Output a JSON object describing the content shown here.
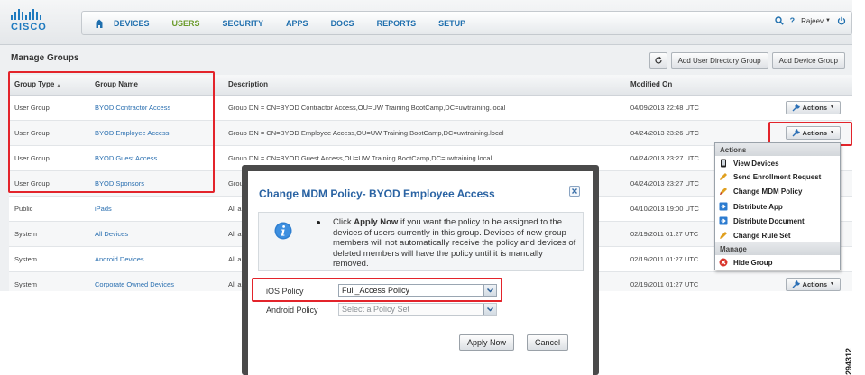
{
  "brand": {
    "logo_text": "CISCO"
  },
  "nav": {
    "items": [
      "DEVICES",
      "USERS",
      "SECURITY",
      "APPS",
      "DOCS",
      "REPORTS",
      "SETUP"
    ],
    "active": "USERS",
    "user": "Rajeev"
  },
  "page": {
    "title": "Manage Groups",
    "toolbar": {
      "add_directory_group": "Add User Directory Group",
      "add_device_group": "Add Device Group"
    }
  },
  "table": {
    "columns": [
      "Group Type",
      "Group Name",
      "Description",
      "Modified On"
    ],
    "sort_indicator": "▲",
    "action_label": "Actions",
    "rows": [
      {
        "type": "User Group",
        "name": "BYOD Contractor Access",
        "desc": "Group DN = CN=BYOD Contractor Access,OU=UW Training BootCamp,DC=uwtraining.local",
        "modified": "04/09/2013 22:48 UTC",
        "actions": true
      },
      {
        "type": "User Group",
        "name": "BYOD Employee Access",
        "desc": "Group DN = CN=BYOD Employee Access,OU=UW Training BootCamp,DC=uwtraining.local",
        "modified": "04/24/2013 23:26 UTC",
        "actions": true
      },
      {
        "type": "User Group",
        "name": "BYOD Guest Access",
        "desc": "Group DN = CN=BYOD Guest Access,OU=UW Training BootCamp,DC=uwtraining.local",
        "modified": "04/24/2013 23:27 UTC",
        "actions": false
      },
      {
        "type": "User Group",
        "name": "BYOD Sponsors",
        "desc": "Grou",
        "modified": "04/24/2013 23:27 UTC",
        "actions": false
      },
      {
        "type": "Public",
        "name": "iPads",
        "desc": "All a",
        "modified": "04/10/2013 19:00 UTC",
        "actions": false
      },
      {
        "type": "System",
        "name": "All Devices",
        "desc": "All a",
        "modified": "02/19/2011 01:27 UTC",
        "actions": false
      },
      {
        "type": "System",
        "name": "Android Devices",
        "desc": "All a",
        "modified": "02/19/2011 01:27 UTC",
        "actions": false
      },
      {
        "type": "System",
        "name": "Corporate Owned Devices",
        "desc": "All a",
        "modified": "02/19/2011 01:27 UTC",
        "actions": true
      }
    ]
  },
  "actions_menu": {
    "section_actions": "Actions",
    "items": [
      "View Devices",
      "Send Enrollment Request",
      "Change MDM Policy",
      "Distribute App",
      "Distribute Document",
      "Change Rule Set"
    ],
    "section_manage": "Manage",
    "manage_items": [
      "Hide Group"
    ]
  },
  "dialog": {
    "title": "Change MDM Policy- BYOD Employee Access",
    "info_pre": "Click ",
    "info_bold": "Apply Now",
    "info_post": "  if you want the policy to be assigned to the devices of users currently in this group. Devices of new group members will not automatically receive the policy and devices of deleted members will have the policy until it is manually removed.",
    "ios_label": "iOS Policy",
    "ios_value": "Full_Access Policy",
    "android_label": "Android Policy",
    "android_value": "Select a Policy Set",
    "apply_label": "Apply Now",
    "cancel_label": "Cancel"
  },
  "figure_id": "294312",
  "colors": {
    "highlight": "#e3242b",
    "link": "#2a6fb0",
    "active_nav": "#6a9a2a",
    "dialog_title": "#2a63a3"
  }
}
